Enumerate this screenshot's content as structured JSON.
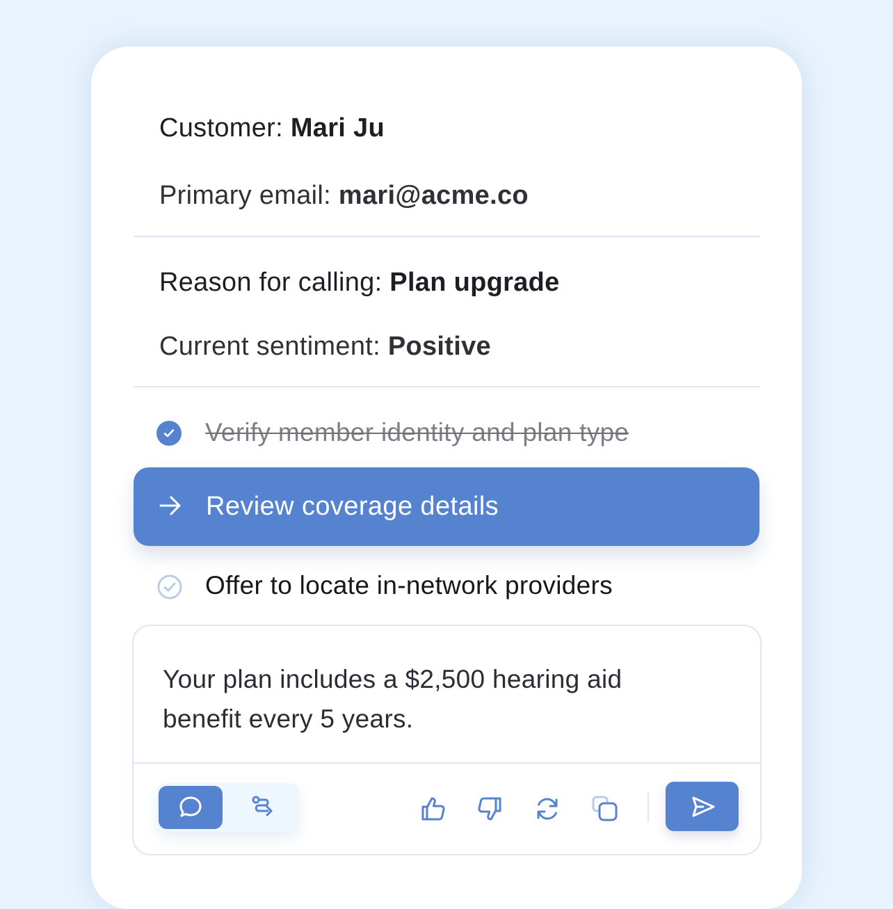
{
  "customer": {
    "label": "Customer:",
    "value": "Mari Ju"
  },
  "email": {
    "label": "Primary email:",
    "value": "mari@acme.co"
  },
  "reason": {
    "label": "Reason for calling:",
    "value": "Plan upgrade"
  },
  "sentiment": {
    "label": "Current sentiment:",
    "value": "Positive"
  },
  "tasks": [
    {
      "label": "Verify member identity and plan type",
      "status": "done"
    },
    {
      "label": "Review coverage details",
      "status": "active"
    },
    {
      "label": "Offer to locate in-network providers",
      "status": "todo"
    }
  ],
  "response": {
    "text": "Your plan includes a $2,500 hearing aid benefit every 5 years."
  },
  "toolbar": {
    "modes": [
      {
        "icon": "chat-bubble-icon",
        "selected": true
      },
      {
        "icon": "route-icon",
        "selected": false
      }
    ],
    "actions": [
      "thumbs-up-icon",
      "thumbs-down-icon",
      "refresh-icon",
      "copy-icon"
    ],
    "send_icon": "send-icon"
  },
  "colors": {
    "accent": "#5683cf",
    "background": "#e9f3fd",
    "divider": "#dde7f3"
  }
}
